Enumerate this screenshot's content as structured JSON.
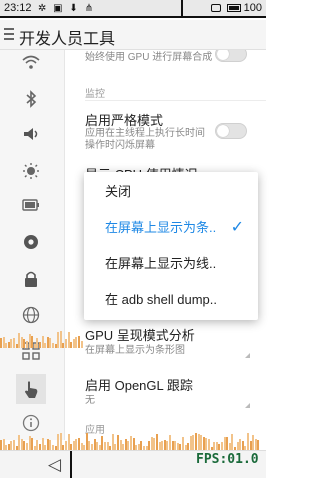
{
  "status_bar": {
    "time": "23:12",
    "icons": [
      "settings-status-icon",
      "image-status-icon",
      "download-status-icon",
      "usb-status-icon"
    ],
    "battery_level": "100"
  },
  "header": {
    "title": "开发人员工具"
  },
  "rail_icons": [
    "wifi-icon",
    "bluetooth-icon",
    "sound-icon",
    "brightness-icon",
    "battery-icon",
    "location-icon",
    "lock-icon",
    "globe-icon",
    "apps-icon",
    "touch-icon",
    "info-icon"
  ],
  "settings": {
    "gpu_rendering_desc": "始终使用 GPU 进行屏幕合成",
    "monitoring_section": "监控",
    "strict_mode_title": "启用严格模式",
    "strict_mode_desc": "应用在主线程上执行长时间操作时闪烁屏幕",
    "cpu_usage_title": "显示 CPU 使用情况",
    "gpu_profile_title": "GPU 呈现模式分析",
    "gpu_profile_value": "在屏幕上显示为条形图",
    "opengl_trace_title": "启用 OpenGL 跟踪",
    "opengl_trace_value": "无",
    "apps_section": "应用"
  },
  "popup_menu": {
    "items": [
      "关闭",
      "在屏幕上显示为条..",
      "在屏幕上显示为线..",
      "在 adb shell dump.."
    ],
    "selected_index": 1
  },
  "overlay": {
    "fps_label": "FPS:01.0"
  },
  "navbar": {
    "back_glyph": "◁"
  }
}
